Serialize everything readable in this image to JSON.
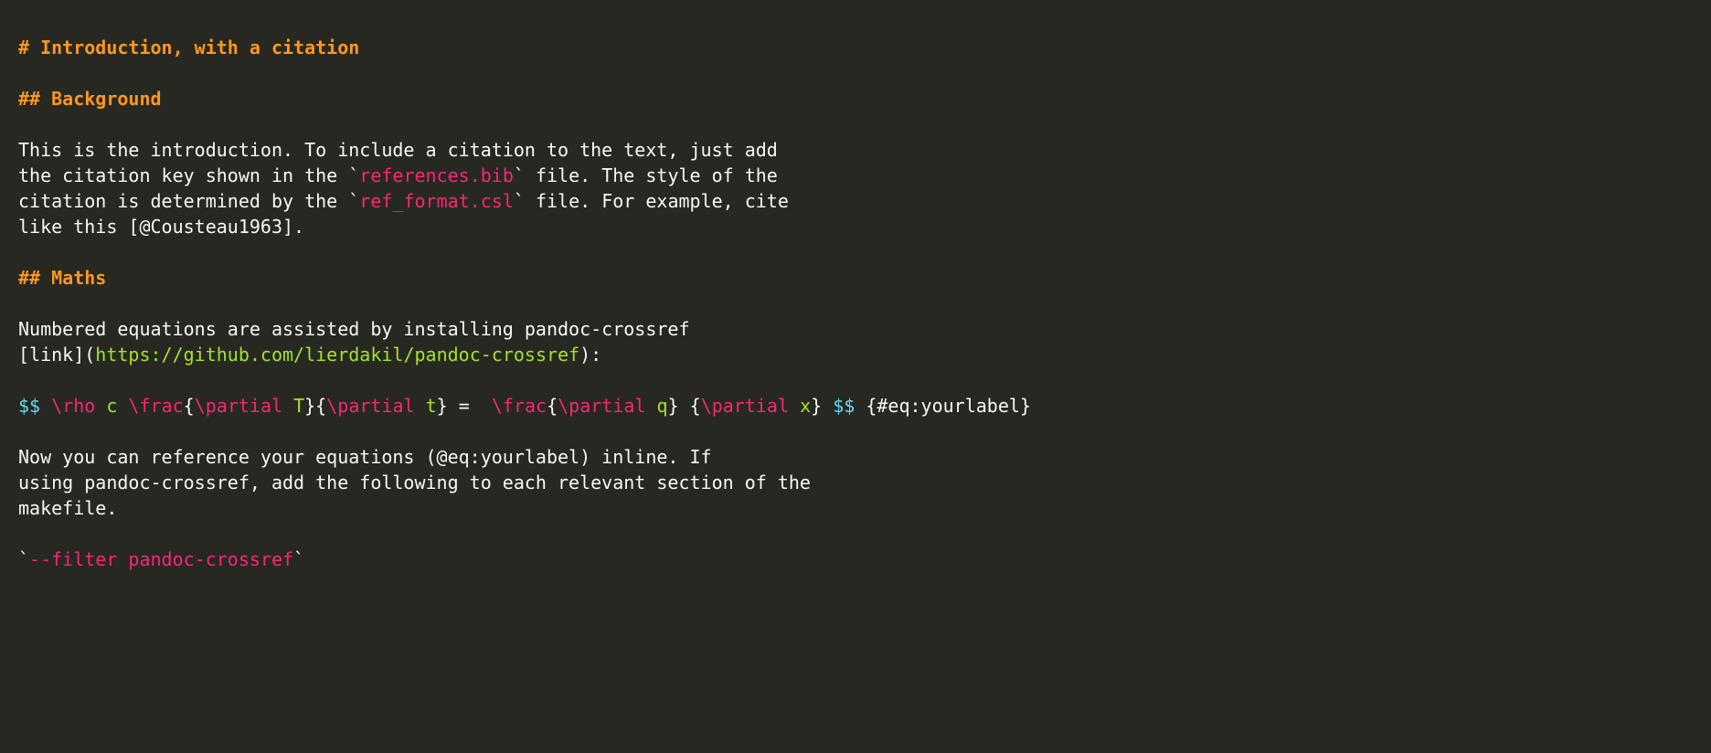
{
  "colors": {
    "background": "#272822",
    "text": "#f8f8f2",
    "heading": "#fd971f",
    "inline_code": "#f92672",
    "link_url": "#a6e22e",
    "math_delim": "#66d9ef",
    "tex_cmd": "#f92672",
    "tex_arg": "#a6e22e"
  },
  "l1": "# Introduction, with a citation",
  "l3": "## Background",
  "l5": "This is the introduction. To include a citation to the text, just add",
  "l6a": "the citation key shown in the ",
  "l6b_bt": "`",
  "l6c_code": "references.bib",
  "l6d_bt": "`",
  "l6e": " file. The style of the",
  "l7a": "citation is determined by the ",
  "l7b_bt": "`",
  "l7c_code": "ref_format.csl",
  "l7d_bt": "`",
  "l7e": " file. For example, cite",
  "l8": "like this [@Cousteau1963].",
  "l10": "## Maths",
  "l12": "Numbered equations are assisted by installing pandoc-crossref",
  "l13a": "[link](",
  "l13b_url": "https://github.com/lierdakil/pandoc-crossref",
  "l13c": "):",
  "l15a": "$$",
  "l15b": " ",
  "l15c_cmd": "\\rho",
  "l15d_sp": " ",
  "l15e_arg": "c",
  "l15f": " ",
  "l15g_cmd": "\\frac",
  "l15h": "{",
  "l15i_cmd": "\\partial ",
  "l15i_arg": "T",
  "l15j": "}{",
  "l15k_cmd": "\\partial ",
  "l15k_arg": "t",
  "l15l": "} =  ",
  "l15m_cmd": "\\frac",
  "l15n": "{",
  "l15o_cmd": "\\partial ",
  "l15o_arg": "q",
  "l15p": "} {",
  "l15q_cmd": "\\partial ",
  "l15q_arg": "x",
  "l15r": "} ",
  "l15s": "$$",
  "l15t": " {#eq:yourlabel}",
  "l17": "Now you can reference your equations (@eq:yourlabel) inline. If",
  "l18": "using pandoc-crossref, add the following to each relevant section of the",
  "l19": "makefile.",
  "l21a_bt": "`",
  "l21b_code": "--filter pandoc-crossref",
  "l21c_bt": "`"
}
